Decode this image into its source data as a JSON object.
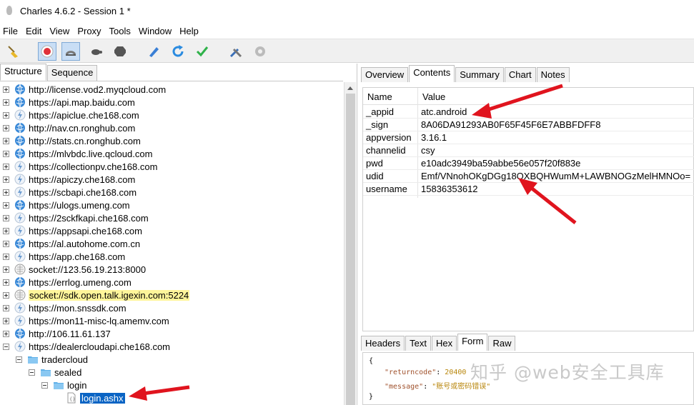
{
  "window": {
    "title": "Charles 4.6.2 - Session 1 *"
  },
  "menu": [
    "File",
    "Edit",
    "View",
    "Proxy",
    "Tools",
    "Window",
    "Help"
  ],
  "toolbar": {
    "buttons": [
      "broom-icon",
      "record-icon",
      "throttle-icon",
      "turtle-icon",
      "stop-icon",
      "pen-icon",
      "refresh-icon",
      "check-icon",
      "tools-icon",
      "gear-icon"
    ]
  },
  "left_tabs": [
    "Structure",
    "Sequence"
  ],
  "tree": [
    {
      "label": "http://license.vod2.myqcloud.com",
      "icon": "globe-icon"
    },
    {
      "label": "https://api.map.baidu.com",
      "icon": "globe-icon"
    },
    {
      "label": "https://apiclue.che168.com",
      "icon": "bolt-icon"
    },
    {
      "label": "http://nav.cn.ronghub.com",
      "icon": "globe-icon"
    },
    {
      "label": "http://stats.cn.ronghub.com",
      "icon": "globe-icon"
    },
    {
      "label": "https://mlvbdc.live.qcloud.com",
      "icon": "globe-icon"
    },
    {
      "label": "https://collectionpv.che168.com",
      "icon": "bolt-icon"
    },
    {
      "label": "https://apiczy.che168.com",
      "icon": "bolt-icon"
    },
    {
      "label": "https://scbapi.che168.com",
      "icon": "bolt-icon"
    },
    {
      "label": "https://ulogs.umeng.com",
      "icon": "globe-icon"
    },
    {
      "label": "https://2sckfkapi.che168.com",
      "icon": "bolt-icon"
    },
    {
      "label": "https://appsapi.che168.com",
      "icon": "bolt-icon"
    },
    {
      "label": "https://al.autohome.com.cn",
      "icon": "globe-icon"
    },
    {
      "label": "https://app.che168.com",
      "icon": "bolt-icon"
    },
    {
      "label": "socket://123.56.19.213:8000",
      "icon": "socket-icon"
    },
    {
      "label": "https://errlog.umeng.com",
      "icon": "globe-icon"
    },
    {
      "label": "socket://sdk.open.talk.igexin.com:5224",
      "icon": "socket-icon"
    },
    {
      "label": "https://mon.snssdk.com",
      "icon": "bolt-icon"
    },
    {
      "label": "https://mon11-misc-lq.amemv.com",
      "icon": "bolt-icon"
    },
    {
      "label": "http://106.11.61.137",
      "icon": "globe-icon"
    },
    {
      "label": "https://dealercloudapi.che168.com",
      "icon": "bolt-icon"
    },
    {
      "label": "tradercloud",
      "icon": "folder-icon"
    },
    {
      "label": "sealed",
      "icon": "folder-icon"
    },
    {
      "label": "login",
      "icon": "folder-icon"
    },
    {
      "label": "login.ashx",
      "icon": "file-icon"
    }
  ],
  "right_tabs": [
    "Overview",
    "Contents",
    "Summary",
    "Chart",
    "Notes"
  ],
  "params_header": {
    "name": "Name",
    "value": "Value"
  },
  "params": [
    {
      "name": "_appid",
      "value": "atc.android"
    },
    {
      "name": "_sign",
      "value": "8A06DA91293AB0F65F45F6E7ABBFDFF8"
    },
    {
      "name": "appversion",
      "value": "3.16.1"
    },
    {
      "name": "channelid",
      "value": "csy"
    },
    {
      "name": "pwd",
      "value": "e10adc3949ba59abbe56e057f20f883e"
    },
    {
      "name": "udid",
      "value": "Emf/VNnohOKgDGg18QXBQHWumM+LAWBNOGzMelHMNOo="
    },
    {
      "name": "username",
      "value": "15836353612"
    }
  ],
  "lower_tabs": [
    "Headers",
    "Text",
    "Hex",
    "Form",
    "Raw"
  ],
  "response": {
    "open": "{",
    "returncode_key": "\"returncode\"",
    "returncode_val": "20400",
    "message_key": "\"message\"",
    "message_val": "\"账号或密码错误\"",
    "close": "}"
  },
  "watermark": "知乎 @web安全工具库"
}
